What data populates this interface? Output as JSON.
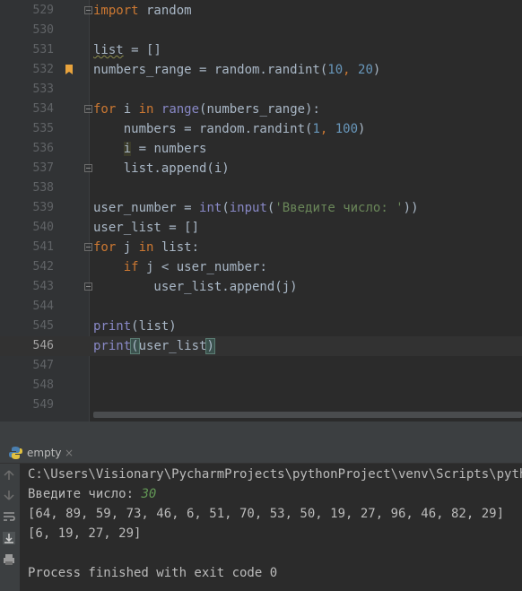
{
  "editor": {
    "lines": [
      {
        "num": "529",
        "tokens": [
          {
            "t": "import",
            "c": "kw"
          },
          {
            "t": " random",
            "c": "plain"
          }
        ]
      },
      {
        "num": "530",
        "tokens": []
      },
      {
        "num": "531",
        "tokens": [
          {
            "t": "list",
            "c": "plain squig"
          },
          {
            "t": " = []",
            "c": "plain"
          }
        ]
      },
      {
        "num": "532",
        "tokens": [
          {
            "t": "numbers_range = random.randint(",
            "c": "plain"
          },
          {
            "t": "10",
            "c": "num"
          },
          {
            "t": ", ",
            "c": "kw"
          },
          {
            "t": "20",
            "c": "num"
          },
          {
            "t": ")",
            "c": "plain"
          }
        ]
      },
      {
        "num": "533",
        "tokens": []
      },
      {
        "num": "534",
        "tokens": [
          {
            "t": "for",
            "c": "kw"
          },
          {
            "t": " i ",
            "c": "plain"
          },
          {
            "t": "in",
            "c": "kw"
          },
          {
            "t": " ",
            "c": "plain"
          },
          {
            "t": "range",
            "c": "fn"
          },
          {
            "t": "(numbers_range):",
            "c": "plain"
          }
        ]
      },
      {
        "num": "535",
        "tokens": [
          {
            "t": "    numbers = random.randint(",
            "c": "plain"
          },
          {
            "t": "1",
            "c": "num"
          },
          {
            "t": ", ",
            "c": "kw"
          },
          {
            "t": "100",
            "c": "num"
          },
          {
            "t": ")",
            "c": "plain"
          }
        ]
      },
      {
        "num": "536",
        "tokens": [
          {
            "t": "    ",
            "c": "plain"
          },
          {
            "t": "i",
            "c": "plain hl-i"
          },
          {
            "t": " = numbers",
            "c": "plain"
          }
        ]
      },
      {
        "num": "537",
        "tokens": [
          {
            "t": "    list.append(i)",
            "c": "plain"
          }
        ]
      },
      {
        "num": "538",
        "tokens": []
      },
      {
        "num": "539",
        "tokens": [
          {
            "t": "user_number = ",
            "c": "plain"
          },
          {
            "t": "int",
            "c": "fn"
          },
          {
            "t": "(",
            "c": "plain"
          },
          {
            "t": "input",
            "c": "fn"
          },
          {
            "t": "(",
            "c": "plain"
          },
          {
            "t": "'Введите число: '",
            "c": "str"
          },
          {
            "t": "))",
            "c": "plain"
          }
        ]
      },
      {
        "num": "540",
        "tokens": [
          {
            "t": "user_list = []",
            "c": "plain"
          }
        ]
      },
      {
        "num": "541",
        "tokens": [
          {
            "t": "for",
            "c": "kw"
          },
          {
            "t": " j ",
            "c": "plain"
          },
          {
            "t": "in",
            "c": "kw"
          },
          {
            "t": " list:",
            "c": "plain"
          }
        ]
      },
      {
        "num": "542",
        "tokens": [
          {
            "t": "    ",
            "c": "plain"
          },
          {
            "t": "if",
            "c": "kw"
          },
          {
            "t": " j < user_number:",
            "c": "plain"
          }
        ]
      },
      {
        "num": "543",
        "tokens": [
          {
            "t": "        user_list.append(j)",
            "c": "plain"
          }
        ]
      },
      {
        "num": "544",
        "tokens": []
      },
      {
        "num": "545",
        "tokens": [
          {
            "t": "print",
            "c": "fn"
          },
          {
            "t": "(list)",
            "c": "plain"
          }
        ]
      },
      {
        "num": "546",
        "tokens": [
          {
            "t": "print",
            "c": "fn"
          },
          {
            "t": "(",
            "c": "plain brace-match"
          },
          {
            "t": "user_list",
            "c": "plain"
          },
          {
            "t": ")",
            "c": "plain brace-match"
          }
        ]
      },
      {
        "num": "547",
        "tokens": []
      },
      {
        "num": "548",
        "tokens": []
      },
      {
        "num": "549",
        "tokens": []
      }
    ],
    "current_line": "546",
    "bookmark_line": "532",
    "fold_lines": [
      "529",
      "534",
      "537",
      "541",
      "543"
    ]
  },
  "run_panel": {
    "tab_label": "empty",
    "tab_close": "×",
    "console": {
      "command": "C:\\Users\\Visionary\\PycharmProjects\\pythonProject\\venv\\Scripts\\python.",
      "prompt": "Введите число: ",
      "user_input": "30",
      "output_list": "[64, 89, 59, 73, 46, 6, 51, 70, 53, 50, 19, 27, 96, 46, 82, 29]",
      "output_user_list": "[6, 19, 27, 29]",
      "blank": "",
      "exit_message": "Process finished with exit code 0"
    },
    "toolbar_icons": [
      "up-arrow-icon",
      "down-arrow-icon",
      "soft-wrap-icon",
      "scroll-to-end-icon",
      "print-icon"
    ]
  },
  "colors": {
    "background": "#2b2b2b",
    "keyword": "#cc7832",
    "number": "#6897bb",
    "string": "#6a8759",
    "builtin": "#8888c6",
    "text": "#a9b7c6",
    "input": "#629755"
  }
}
